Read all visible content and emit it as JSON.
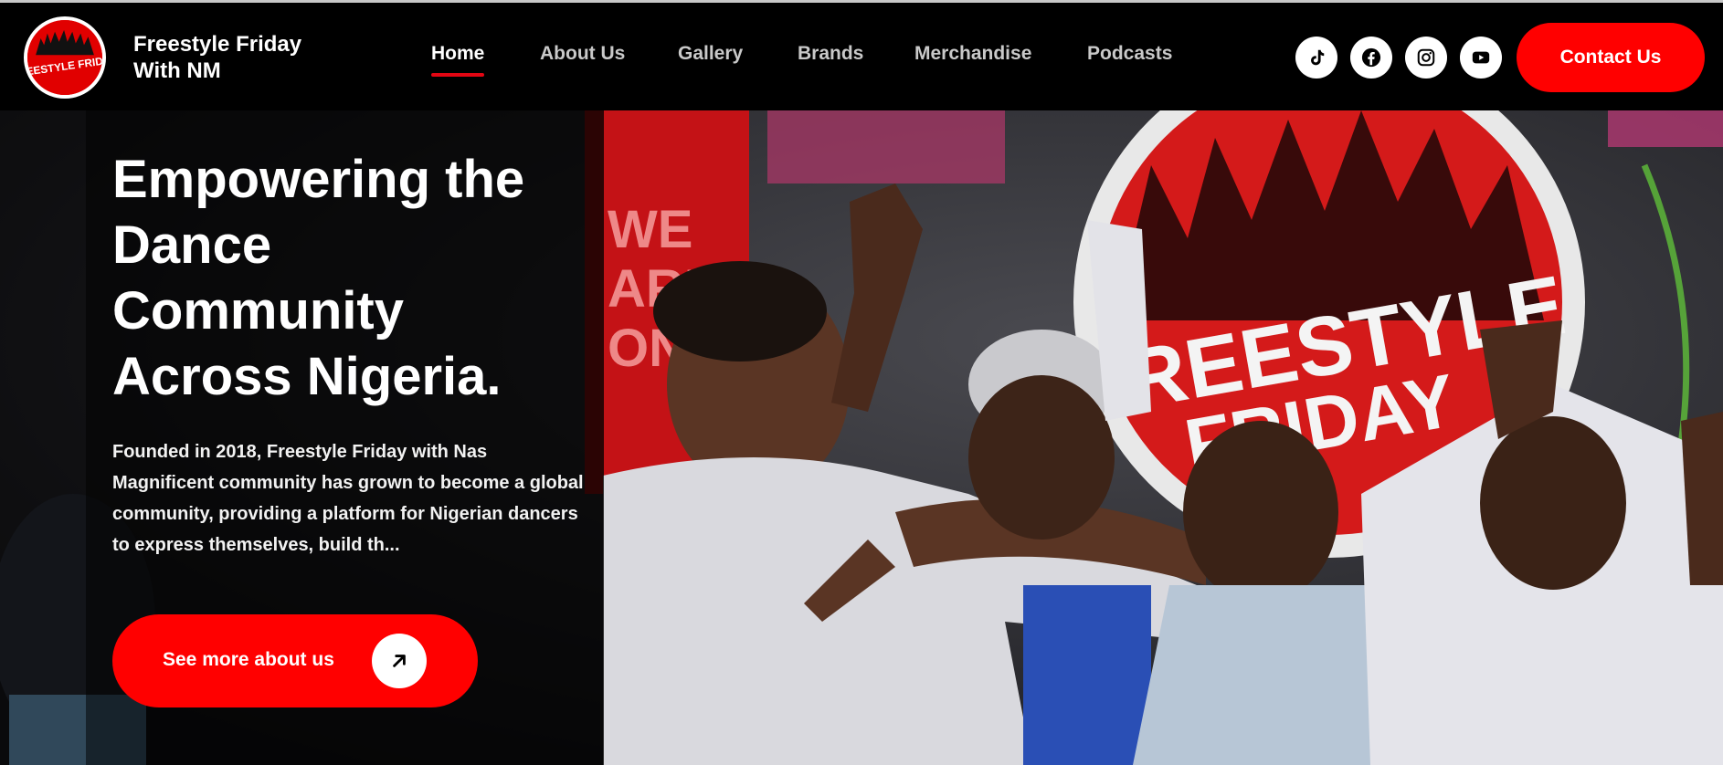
{
  "brand": {
    "logo_text": "FREESTYLE FRIDAY",
    "name_line1": "Freestyle Friday",
    "name_line2": "With NM"
  },
  "nav": {
    "items": [
      {
        "label": "Home",
        "active": true
      },
      {
        "label": "About Us",
        "active": false
      },
      {
        "label": "Gallery",
        "active": false
      },
      {
        "label": "Brands",
        "active": false
      },
      {
        "label": "Merchandise",
        "active": false
      },
      {
        "label": "Podcasts",
        "active": false
      }
    ]
  },
  "social": [
    "tiktok-icon",
    "facebook-icon",
    "instagram-icon",
    "youtube-icon"
  ],
  "contact_button": "Contact Us",
  "hero": {
    "title_lines": [
      "Empowering the",
      "Dance",
      "Community",
      "Across Nigeria."
    ],
    "description": "Founded in 2018, Freestyle Friday with Nas Magnificent community has grown to become a global community, providing a platform for Nigerian dancers to express themselves, build th...",
    "cta_label": "See more about us",
    "photo_sign_text": [
      "FREESTYLE",
      "FRIDAY"
    ],
    "banner_text": [
      "WE",
      "ARE",
      "ONE"
    ]
  },
  "colors": {
    "accent": "#ff0000",
    "header_bg": "#000000",
    "nav_inactive": "#c9c9c9",
    "nav_active": "#ffffff"
  }
}
